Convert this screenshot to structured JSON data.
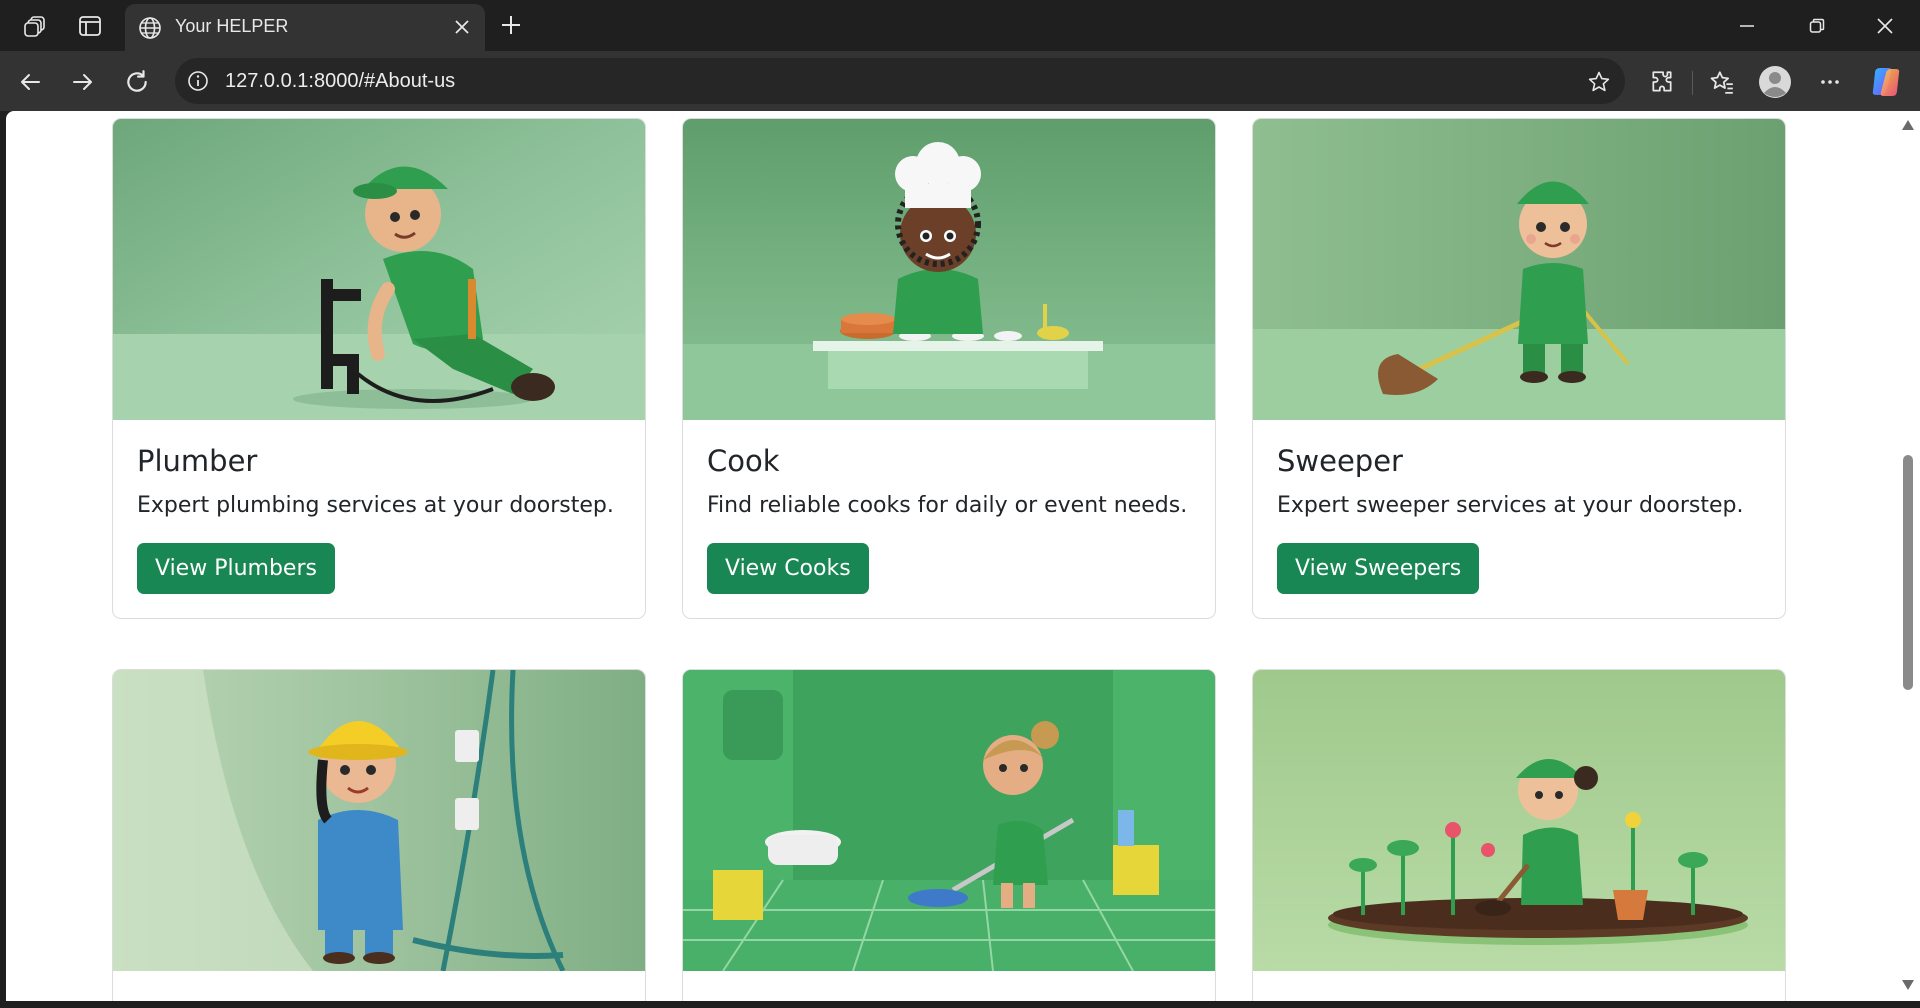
{
  "browser": {
    "tab_title": "Your HELPER",
    "url": "127.0.0.1:8000/#About-us"
  },
  "cards": [
    {
      "title": "Plumber",
      "text": "Expert plumbing services at your doorstep.",
      "button": "View Plumbers"
    },
    {
      "title": "Cook",
      "text": "Find reliable cooks for daily or event needs.",
      "button": "View Cooks"
    },
    {
      "title": "Sweeper",
      "text": "Expert sweeper services at your doorstep.",
      "button": "View Sweepers"
    }
  ],
  "colors": {
    "button_green": "#198754",
    "image_green": "#6fae7c"
  }
}
